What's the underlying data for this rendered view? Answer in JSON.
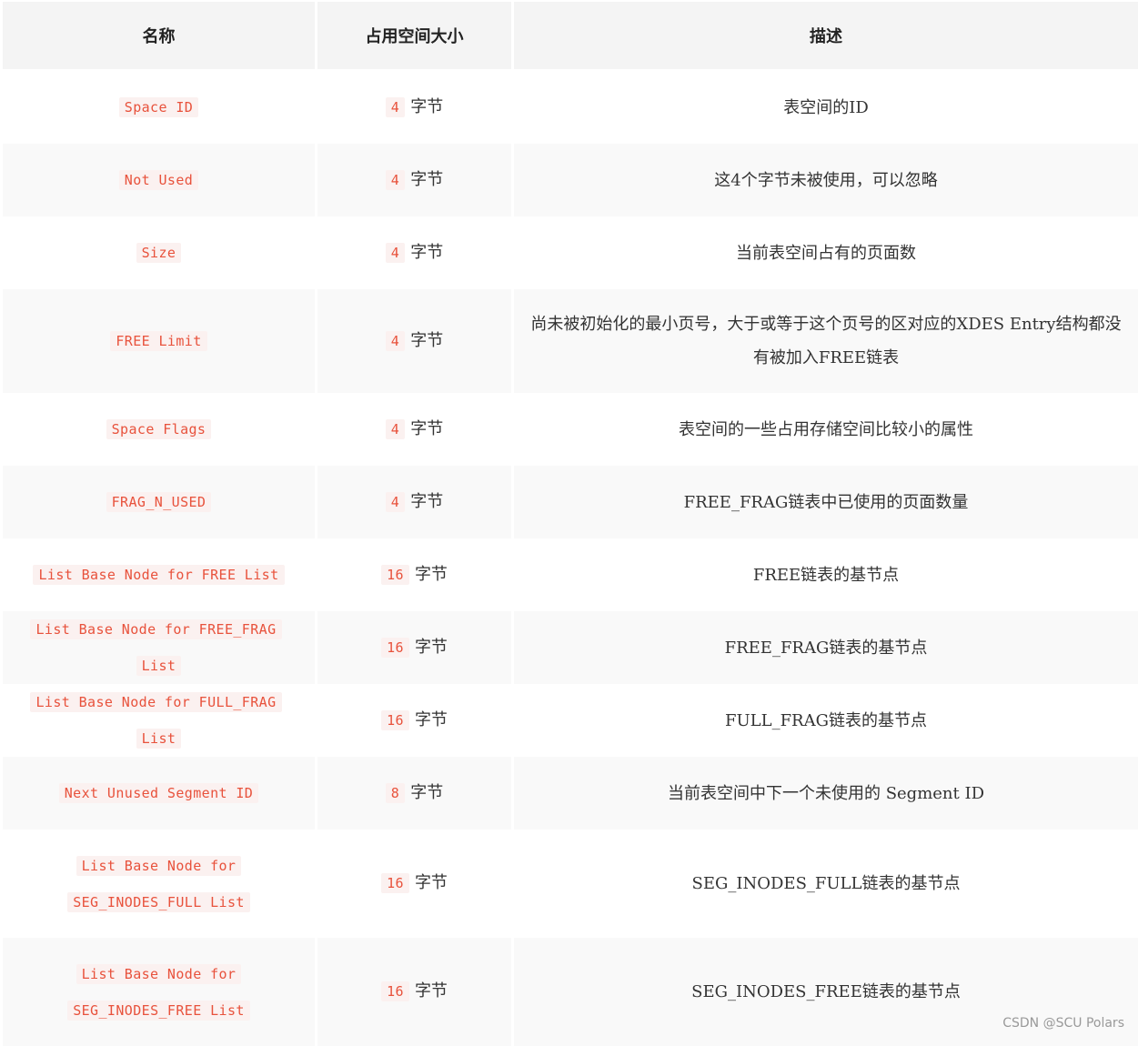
{
  "table": {
    "headers": [
      "名称",
      "占用空间大小",
      "描述"
    ],
    "rows": [
      {
        "name": "Space ID",
        "size_num": "4",
        "size_unit": "字节",
        "desc": "表空间的ID"
      },
      {
        "name": "Not Used",
        "size_num": "4",
        "size_unit": "字节",
        "desc": "这4个字节未被使用，可以忽略"
      },
      {
        "name": "Size",
        "size_num": "4",
        "size_unit": "字节",
        "desc": "当前表空间占有的页面数"
      },
      {
        "name": "FREE Limit",
        "size_num": "4",
        "size_unit": "字节",
        "desc": "尚未被初始化的最小页号，大于或等于这个页号的区对应的XDES Entry结构都没有被加入FREE链表"
      },
      {
        "name": "Space Flags",
        "size_num": "4",
        "size_unit": "字节",
        "desc": "表空间的一些占用存储空间比较小的属性"
      },
      {
        "name": "FRAG_N_USED",
        "size_num": "4",
        "size_unit": "字节",
        "desc": "FREE_FRAG链表中已使用的页面数量"
      },
      {
        "name": "List Base Node for FREE List",
        "size_num": "16",
        "size_unit": "字节",
        "desc": "FREE链表的基节点"
      },
      {
        "name": "List Base Node for FREE_FRAG List",
        "size_num": "16",
        "size_unit": "字节",
        "desc": "FREE_FRAG链表的基节点"
      },
      {
        "name": "List Base Node for FULL_FRAG List",
        "size_num": "16",
        "size_unit": "字节",
        "desc": "FULL_FRAG链表的基节点"
      },
      {
        "name": "Next Unused Segment ID",
        "size_num": "8",
        "size_unit": "字节",
        "desc": "当前表空间中下一个未使用的 Segment ID"
      },
      {
        "name": "List Base Node for SEG_INODES_FULL List",
        "size_num": "16",
        "size_unit": "字节",
        "desc": "SEG_INODES_FULL链表的基节点"
      },
      {
        "name": "List Base Node for SEG_INODES_FREE List",
        "size_num": "16",
        "size_unit": "字节",
        "desc": "SEG_INODES_FREE链表的基节点"
      }
    ]
  },
  "watermark": "CSDN @SCU Polars"
}
